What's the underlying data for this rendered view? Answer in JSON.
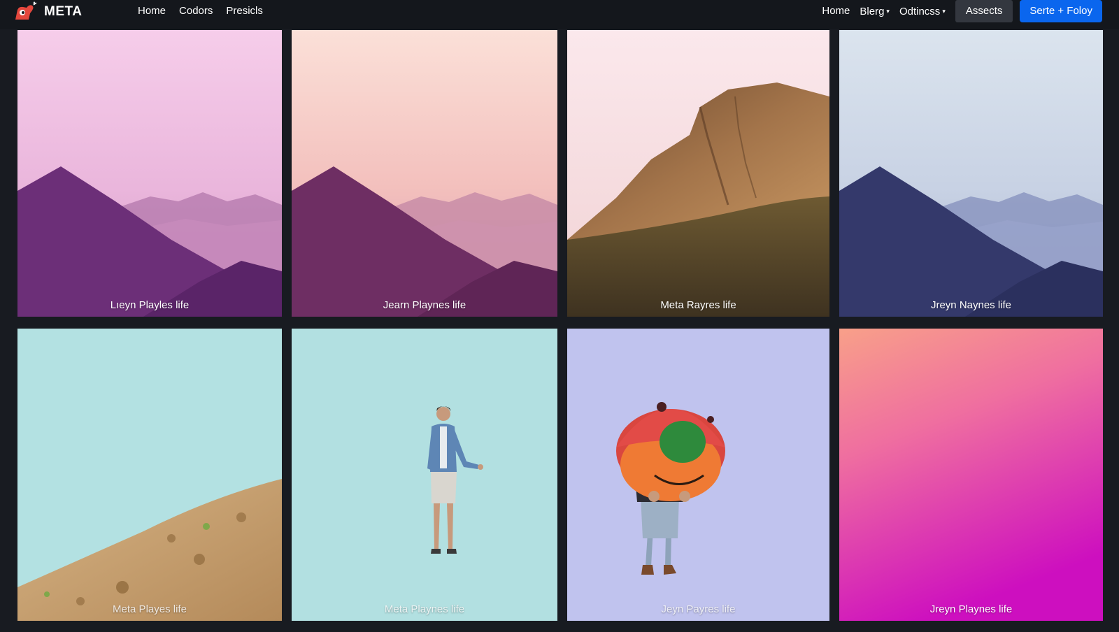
{
  "brand": {
    "name": "META",
    "logo_icon": "meta-mascot-logo-icon"
  },
  "nav_left": [
    {
      "label": "Home"
    },
    {
      "label": "Codors"
    },
    {
      "label": "Presicls"
    }
  ],
  "nav_right": [
    {
      "label": "Home",
      "dropdown": false
    },
    {
      "label": "Blerg",
      "dropdown": true
    },
    {
      "label": "Odtincss",
      "dropdown": true
    }
  ],
  "caret_glyph": "▾",
  "buttons": {
    "assets": "Assects",
    "primary": "Serte + Foloy"
  },
  "colors": {
    "topbar": "#14171c",
    "page_bg": "#181b21",
    "assets_bg": "#33373f",
    "primary": "#0a66ee"
  },
  "gallery": [
    {
      "caption": "Lıeyn Playles life",
      "image": "purple-mountains-pink-sky"
    },
    {
      "caption": "Jearn Playnes life",
      "image": "purple-mountains-peach-sky"
    },
    {
      "caption": "Meta Rayres life",
      "image": "brown-rocky-mountain-grass"
    },
    {
      "caption": "Jreyn Naynes life",
      "image": "navy-mountains-pale-blue-sky"
    },
    {
      "caption": "Meta Playes life",
      "image": "sandy-hill-teal-sky"
    },
    {
      "caption": "Meta Playnes life",
      "image": "man-standing-teal-background"
    },
    {
      "caption": "Jeyn Payres life",
      "image": "person-holding-red-orange-ball-lavender-background"
    },
    {
      "caption": "Jreyn Playnes life",
      "image": "peach-to-magenta-gradient"
    }
  ]
}
